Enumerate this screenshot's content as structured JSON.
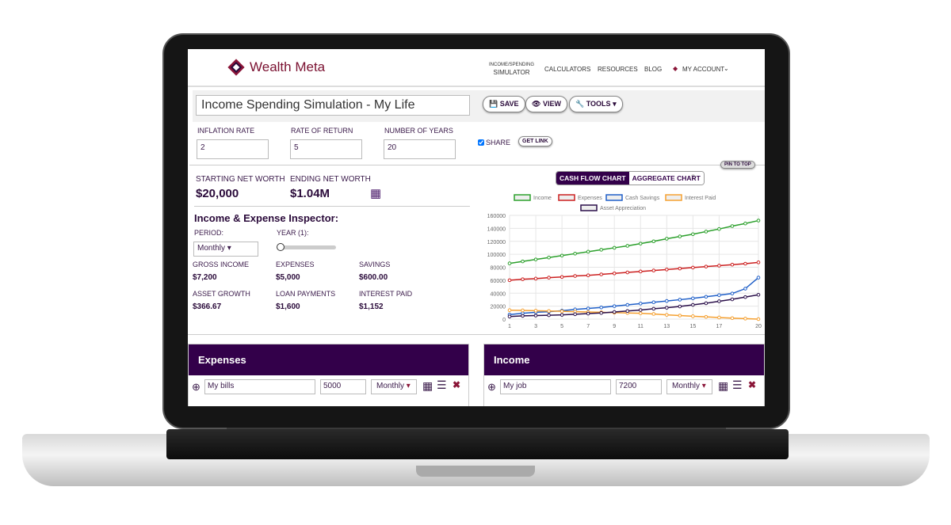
{
  "brand": {
    "name": "Wealth Meta"
  },
  "nav": {
    "items": [
      "INCOME/SPENDING",
      "SIMULATOR",
      "CALCULATORS",
      "RESOURCES",
      "BLOG",
      "MY ACCOUNT"
    ]
  },
  "toolbar": {
    "title_value": "Income Spending Simulation - My Life",
    "save": "SAVE",
    "view": "VIEW",
    "tools": "TOOLS"
  },
  "params": {
    "inflation_label": "INFLATION RATE",
    "inflation": "2",
    "return_label": "RATE OF RETURN",
    "return": "5",
    "years_label": "NUMBER OF YEARS",
    "years": "20",
    "share_label": "SHARE",
    "share_checked": true,
    "get_link": "GET LINK",
    "pin": "PIN TO TOP"
  },
  "summary": {
    "start_label": "STARTING NET WORTH",
    "start": "$20,000",
    "end_label": "ENDING NET WORTH",
    "end": "$1.04M"
  },
  "inspector": {
    "title": "Income & Expense Inspector:",
    "period_label": "PERIOD:",
    "period": "Monthly",
    "year_label": "YEAR (1):",
    "year_slider": 1,
    "stats": [
      {
        "label": "GROSS INCOME",
        "value": "$7,200"
      },
      {
        "label": "EXPENSES",
        "value": "$5,000"
      },
      {
        "label": "SAVINGS",
        "value": "$600.00"
      },
      {
        "label": "ASSET GROWTH",
        "value": "$366.67"
      },
      {
        "label": "LOAN PAYMENTS",
        "value": "$1,600"
      },
      {
        "label": "INTEREST PAID",
        "value": "$1,152"
      }
    ]
  },
  "chart_tabs": {
    "active": "CASH FLOW CHART",
    "other": "AGGREGATE CHART"
  },
  "chart_data": {
    "type": "line",
    "x": [
      1,
      2,
      3,
      4,
      5,
      6,
      7,
      8,
      9,
      10,
      11,
      12,
      13,
      14,
      15,
      16,
      17,
      18,
      19,
      20
    ],
    "xticks": [
      "1",
      "3",
      "5",
      "7",
      "9",
      "11",
      "13",
      "15",
      "17",
      "20"
    ],
    "yticks": [
      "0",
      "20000",
      "40000",
      "60000",
      "80000",
      "100000",
      "120000",
      "140000",
      "160000"
    ],
    "ylim": [
      0,
      160000
    ],
    "grid": true,
    "legend": "top",
    "series": [
      {
        "name": "Income",
        "color": "#2ca02c",
        "values": [
          86000,
          89000,
          92000,
          95000,
          98000,
          101000,
          104000,
          107000,
          110000,
          113000,
          116500,
          120000,
          124000,
          127500,
          131000,
          135000,
          139000,
          143500,
          147500,
          152000
        ]
      },
      {
        "name": "Expenses",
        "color": "#cc1f1f",
        "values": [
          60000,
          61500,
          62500,
          64000,
          65000,
          66500,
          67500,
          69000,
          70500,
          72000,
          73500,
          75000,
          76500,
          78000,
          79500,
          81000,
          82500,
          84000,
          85500,
          87500
        ]
      },
      {
        "name": "Cash Savings",
        "color": "#1f5fc8",
        "values": [
          7000,
          9000,
          10500,
          11500,
          13000,
          15000,
          16500,
          18000,
          20000,
          22000,
          24000,
          26000,
          28000,
          30000,
          32000,
          34500,
          37000,
          39500,
          47000,
          64000
        ]
      },
      {
        "name": "Interest Paid",
        "color": "#f5a030",
        "values": [
          13800,
          13500,
          13000,
          12500,
          12000,
          11500,
          11000,
          10500,
          10000,
          9500,
          9000,
          8000,
          6500,
          5500,
          4500,
          3500,
          2500,
          1500,
          800,
          0
        ]
      },
      {
        "name": "Asset Appreciation",
        "color": "#2a0f4a",
        "values": [
          4000,
          5000,
          5500,
          6000,
          6500,
          7500,
          8500,
          9500,
          11000,
          12500,
          14000,
          16000,
          17500,
          19500,
          22000,
          24500,
          27500,
          30500,
          34000,
          37500
        ]
      }
    ]
  },
  "expenses": {
    "title": "Expenses",
    "name": "My bills",
    "amount": "5000",
    "period": "Monthly"
  },
  "income": {
    "title": "Income",
    "name": "My job",
    "amount": "7200",
    "period": "Monthly"
  }
}
